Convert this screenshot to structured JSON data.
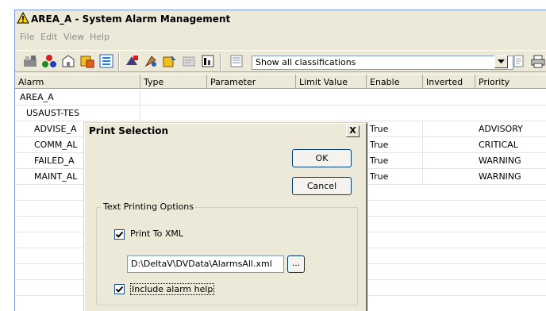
{
  "window": {
    "title": "AREA_A - System Alarm Management"
  },
  "menu": [
    "File",
    "Edit",
    "View",
    "Help"
  ],
  "toolbar": {
    "classification_filter": "Show all classifications"
  },
  "grid": {
    "columns": [
      "Alarm",
      "Type",
      "Parameter",
      "Limit Value",
      "Enable",
      "Inverted",
      "Priority"
    ],
    "rows": [
      {
        "alarm": "AREA_A",
        "enable": "",
        "priority": ""
      },
      {
        "alarm": "USAUST-TES",
        "enable": "",
        "priority": ""
      },
      {
        "alarm": "ADVISE_A",
        "enable": "True",
        "priority": "ADVISORY"
      },
      {
        "alarm": "COMM_AL",
        "enable": "True",
        "priority": "CRITICAL"
      },
      {
        "alarm": "FAILED_A",
        "enable": "True",
        "priority": "WARNING"
      },
      {
        "alarm": "MAINT_AL",
        "enable": "True",
        "priority": "WARNING"
      }
    ]
  },
  "dialog": {
    "title": "Print Selection",
    "close_label": "X",
    "ok_label": "OK",
    "cancel_label": "Cancel",
    "group_label": "Text Printing Options",
    "print_to_xml_label": "Print To XML",
    "print_to_xml_checked": true,
    "xml_path": "D:\\DeltaV\\DVData\\AlarmsAll.xml",
    "browse_label": "...",
    "include_help_label": "Include alarm help",
    "include_help_checked": true
  }
}
